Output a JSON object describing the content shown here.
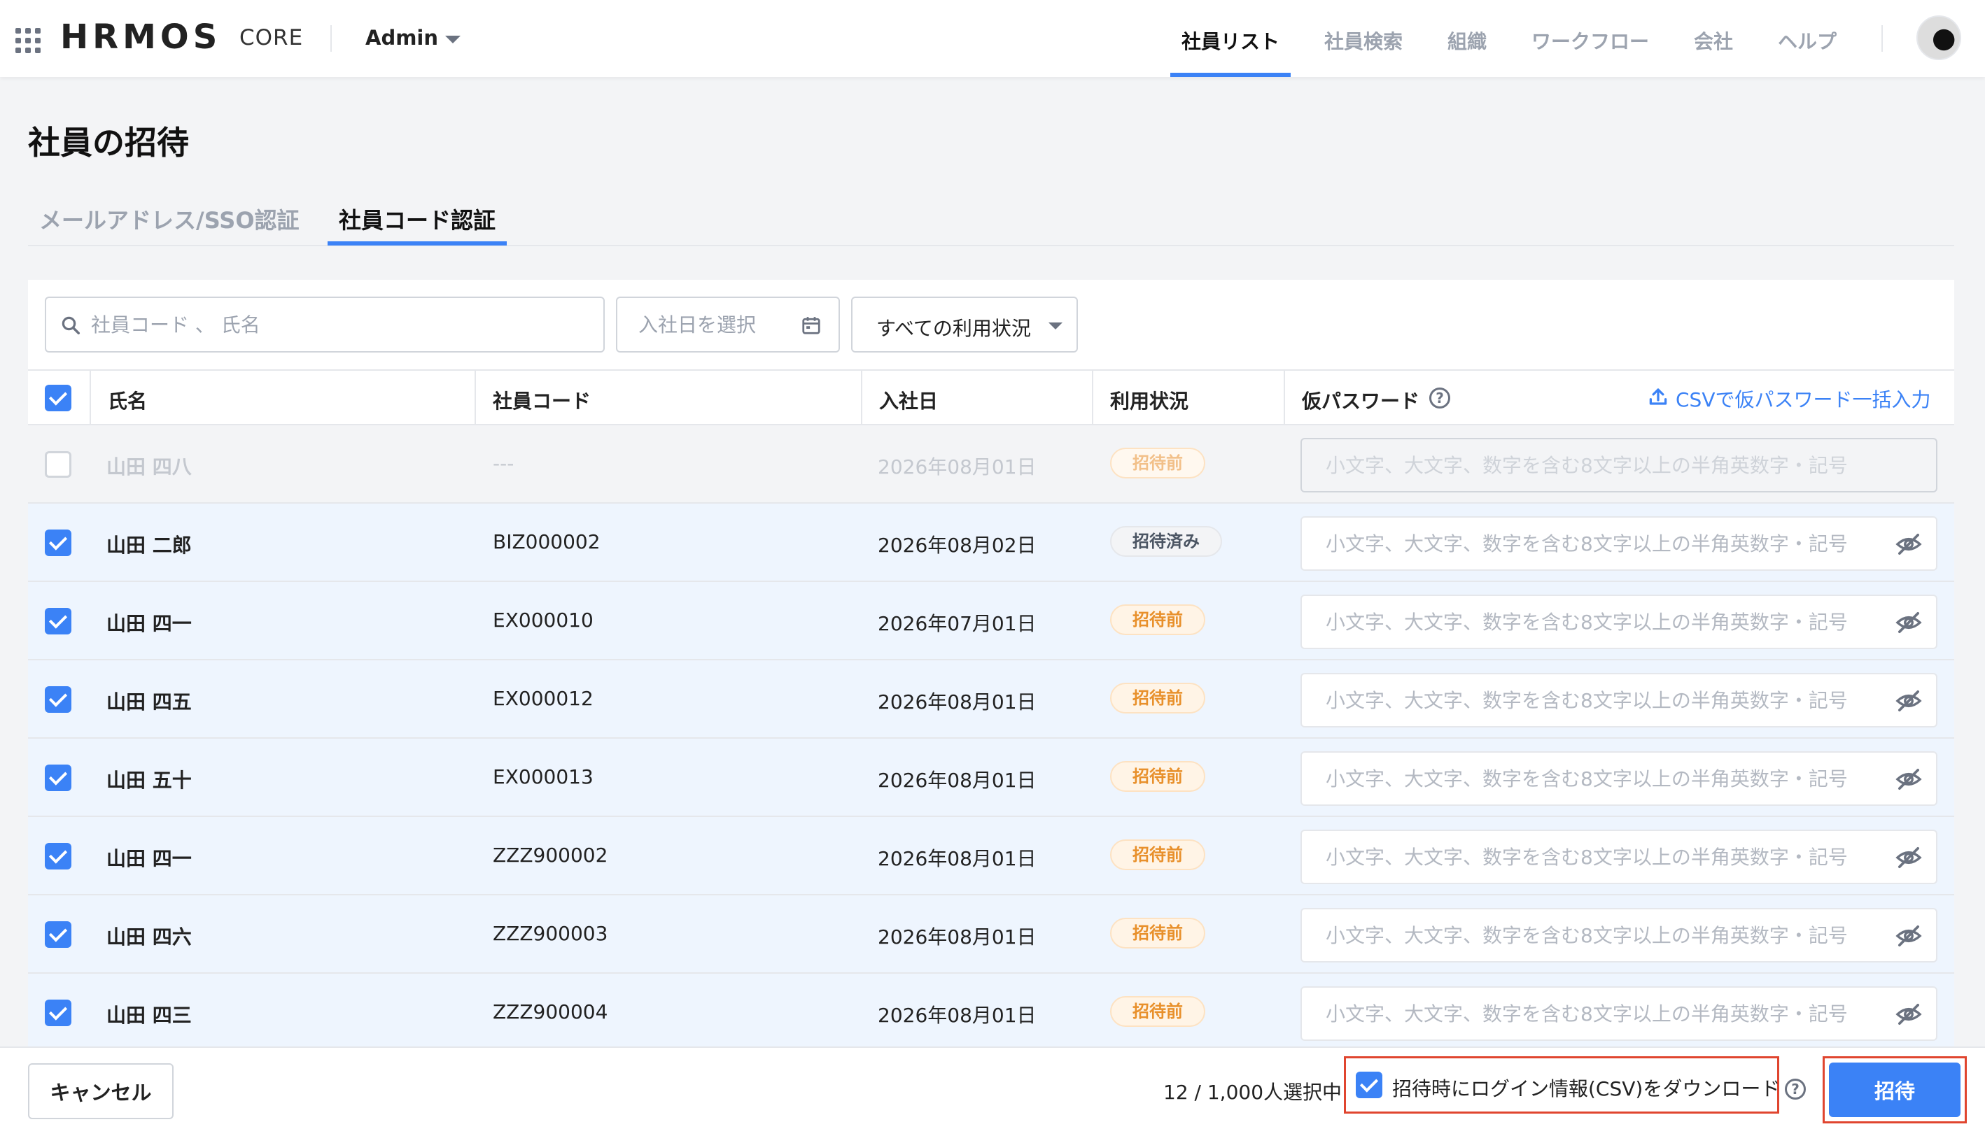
{
  "header": {
    "logo": "HRMOS",
    "logo_sub": "CORE",
    "org_name": "Admin",
    "nav": [
      {
        "label": "社員リスト",
        "active": true
      },
      {
        "label": "社員検索"
      },
      {
        "label": "組織"
      },
      {
        "label": "ワークフロー"
      },
      {
        "label": "会社"
      },
      {
        "label": "ヘルプ"
      }
    ]
  },
  "page": {
    "title": "社員の招待",
    "tabs": [
      {
        "label": "メールアドレス/SSO認証"
      },
      {
        "label": "社員コード認証",
        "active": true
      }
    ]
  },
  "filters": {
    "search_placeholder": "社員コード 、 氏名",
    "date_placeholder": "入社日を選択",
    "status_select": "すべての利用状況"
  },
  "table": {
    "headers": {
      "name": "氏名",
      "code": "社員コード",
      "join_date": "入社日",
      "status": "利用状況",
      "temp_password": "仮パスワード"
    },
    "csv_link": "CSVで仮パスワード一括入力",
    "password_placeholder": "小文字、大文字、数字を含む8文字以上の半角英数字・記号",
    "rows": [
      {
        "name": "山田 四八",
        "code": "---",
        "date": "2026年08月01日",
        "status": "招待前",
        "checked": false,
        "disabled": true
      },
      {
        "name": "山田 二郎",
        "code": "BIZ000002",
        "date": "2026年08月02日",
        "status": "招待済み",
        "checked": true
      },
      {
        "name": "山田 四一",
        "code": "EX000010",
        "date": "2026年07月01日",
        "status": "招待前",
        "checked": true
      },
      {
        "name": "山田 四五",
        "code": "EX000012",
        "date": "2026年08月01日",
        "status": "招待前",
        "checked": true
      },
      {
        "name": "山田 五十",
        "code": "EX000013",
        "date": "2026年08月01日",
        "status": "招待前",
        "checked": true
      },
      {
        "name": "山田 四一",
        "code": "ZZZ900002",
        "date": "2026年08月01日",
        "status": "招待前",
        "checked": true
      },
      {
        "name": "山田 四六",
        "code": "ZZZ900003",
        "date": "2026年08月01日",
        "status": "招待前",
        "checked": true
      },
      {
        "name": "山田 四三",
        "code": "ZZZ900004",
        "date": "2026年08月01日",
        "status": "招待前",
        "checked": true
      }
    ]
  },
  "footer": {
    "cancel": "キャンセル",
    "selection_count": "12 / 1,000人選択中",
    "download_label": "招待時にログイン情報(CSV)をダウンロード",
    "invite": "招待"
  },
  "colors": {
    "accent": "#3b82f6",
    "badge_pending_text": "#e8902b",
    "highlight_border": "#e0452f",
    "selected_row_bg": "#eef5fe"
  }
}
